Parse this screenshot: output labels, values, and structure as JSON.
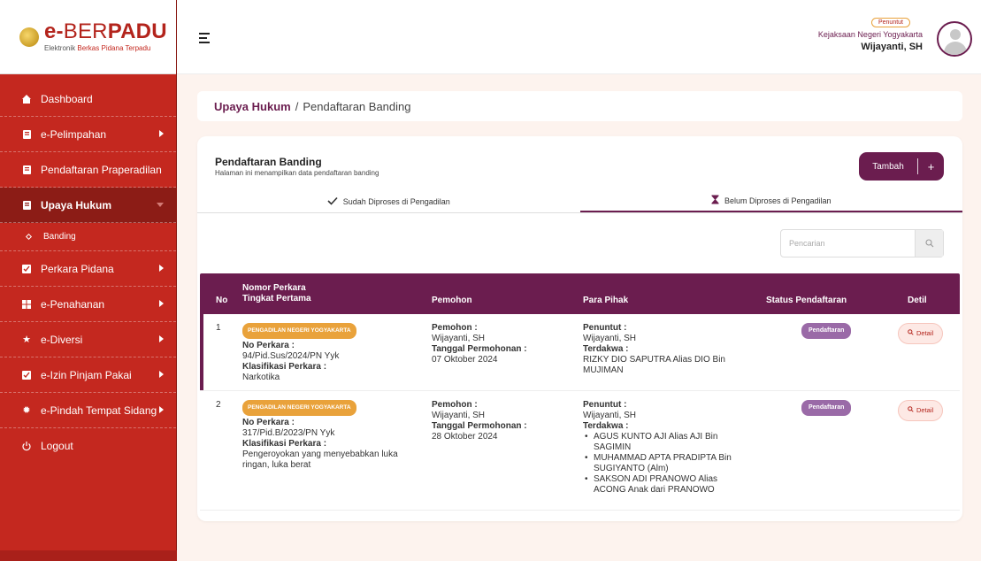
{
  "app": {
    "logo_main_bold": "e-",
    "logo_main_thin": "BER",
    "logo_main_bold2": "PADU",
    "logo_sub_1": "Elektronik ",
    "logo_sub_2": "Berkas Pidana Terpadu"
  },
  "sidebar": {
    "items": [
      {
        "label": "Dashboard",
        "icon": "home-icon"
      },
      {
        "label": "e-Pelimpahan",
        "icon": "document-icon"
      },
      {
        "label": "Pendaftaran Praperadilan",
        "icon": "document-icon"
      },
      {
        "label": "Upaya Hukum",
        "icon": "document-icon"
      },
      {
        "label": "Banding",
        "icon": "diamond-icon"
      },
      {
        "label": "Perkara Pidana",
        "icon": "checkbox-icon"
      },
      {
        "label": "e-Penahanan",
        "icon": "grid-icon"
      },
      {
        "label": "e-Diversi",
        "icon": "star-icon"
      },
      {
        "label": "e-Izin Pinjam Pakai",
        "icon": "checkbox-icon"
      },
      {
        "label": "e-Pindah Tempat Sidang",
        "icon": "gear-icon"
      },
      {
        "label": "Logout",
        "icon": "power-icon"
      }
    ]
  },
  "header": {
    "role": "Penuntut",
    "office": "Kejaksaan Negeri Yogyakarta",
    "username": "Wijayanti, SH"
  },
  "breadcrumb": {
    "parent": "Upaya Hukum",
    "separator": "/",
    "current": "Pendaftaran Banding"
  },
  "page": {
    "title": "Pendaftaran Banding",
    "subtitle": "Halaman ini menampilkan data pendaftaran banding",
    "add_label": "Tambah",
    "add_plus": "+",
    "tabs": [
      {
        "label": "Sudah Diproses di Pengadilan",
        "icon": "check-icon",
        "active": false
      },
      {
        "label": "Belum Diproses di Pengadilan",
        "icon": "hourglass-icon",
        "active": true
      }
    ],
    "search_placeholder": "Pencarian"
  },
  "table": {
    "headers": {
      "no": "No",
      "perkara_1": "Nomor Perkara",
      "perkara_2": "Tingkat Pertama",
      "pemohon": "Pemohon",
      "pihak": "Para Pihak",
      "status": "Status Pendaftaran",
      "detil": "Detil"
    },
    "rows": [
      {
        "no": "1",
        "court": "PENGADILAN NEGERI YOGYAKARTA",
        "no_perkara_label": "No Perkara :",
        "no_perkara": "94/Pid.Sus/2024/PN Yyk",
        "klasifikasi_label": "Klasifikasi Perkara :",
        "klasifikasi": "Narkotika",
        "pemohon_label": "Pemohon :",
        "pemohon": "Wijayanti, SH",
        "tanggal_label": "Tanggal Permohonan :",
        "tanggal": "07 Oktober 2024",
        "penuntut_label": "Penuntut :",
        "penuntut": "Wijayanti, SH",
        "terdakwa_label": "Terdakwa :",
        "terdakwa": "RIZKY DIO SAPUTRA Alias DIO Bin MUJIMAN",
        "status": "Pendaftaran",
        "detail": "Detail"
      },
      {
        "no": "2",
        "court": "PENGADILAN NEGERI YOGYAKARTA",
        "no_perkara_label": "No Perkara :",
        "no_perkara": "317/Pid.B/2023/PN Yyk",
        "klasifikasi_label": "Klasifikasi Perkara :",
        "klasifikasi": "Pengeroyokan yang menyebabkan luka ringan, luka berat",
        "pemohon_label": "Pemohon :",
        "pemohon": "Wijayanti, SH",
        "tanggal_label": "Tanggal Permohonan :",
        "tanggal": "28 Oktober 2024",
        "penuntut_label": "Penuntut :",
        "penuntut": "Wijayanti, SH",
        "terdakwa_label": "Terdakwa :",
        "terdakwa_list": [
          "AGUS KUNTO AJI Alias AJI Bin SAGIMIN",
          "MUHAMMAD APTA PRADIPTA Bin SUGIYANTO (Alm)",
          "SAKSON ADI PRANOWO Alias ACONG Anak dari PRANOWO"
        ],
        "status": "Pendaftaran",
        "detail": "Detail"
      }
    ]
  },
  "colors": {
    "primary": "#6b1d4f",
    "sidebar": "#c4281f",
    "badge_orange": "#e9a23b",
    "status_purple": "#9a6aa7"
  }
}
